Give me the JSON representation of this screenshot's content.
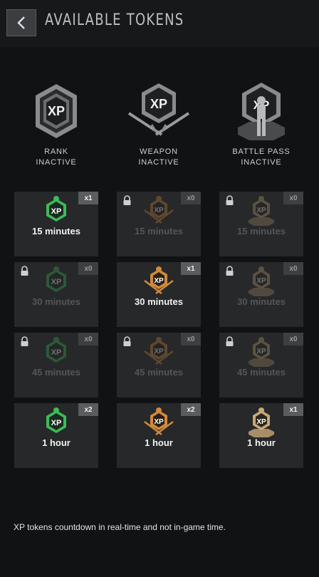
{
  "header": {
    "title": "AVAILABLE TOKENS",
    "back_icon": "chevron-left-icon"
  },
  "categories": [
    {
      "line1": "RANK",
      "line2": "INACTIVE",
      "icon": "rank-xp-emblem-icon"
    },
    {
      "line1": "WEAPON",
      "line2": "INACTIVE",
      "icon": "weapon-xp-emblem-icon"
    },
    {
      "line1": "BATTLE PASS",
      "line2": "INACTIVE",
      "icon": "battlepass-xp-emblem-icon"
    }
  ],
  "colors": {
    "rank": "#3dbb5a",
    "weapon": "#d08a3c",
    "battle_pass": "#c7a877"
  },
  "tokens": [
    [
      {
        "type": "rank",
        "duration": "15 minutes",
        "count": "x1",
        "locked": false
      },
      {
        "type": "weapon",
        "duration": "15 minutes",
        "count": "x0",
        "locked": true
      },
      {
        "type": "battle_pass",
        "duration": "15 minutes",
        "count": "x0",
        "locked": true
      }
    ],
    [
      {
        "type": "rank",
        "duration": "30 minutes",
        "count": "x0",
        "locked": true
      },
      {
        "type": "weapon",
        "duration": "30 minutes",
        "count": "x1",
        "locked": false
      },
      {
        "type": "battle_pass",
        "duration": "30 minutes",
        "count": "x0",
        "locked": true
      }
    ],
    [
      {
        "type": "rank",
        "duration": "45 minutes",
        "count": "x0",
        "locked": true
      },
      {
        "type": "weapon",
        "duration": "45 minutes",
        "count": "x0",
        "locked": true
      },
      {
        "type": "battle_pass",
        "duration": "45 minutes",
        "count": "x0",
        "locked": true
      }
    ],
    [
      {
        "type": "rank",
        "duration": "1 hour",
        "count": "x2",
        "locked": false
      },
      {
        "type": "weapon",
        "duration": "1 hour",
        "count": "x2",
        "locked": false
      },
      {
        "type": "battle_pass",
        "duration": "1 hour",
        "count": "x1",
        "locked": false
      }
    ]
  ],
  "footer": {
    "note": "XP tokens countdown in real-time and not in-game time."
  }
}
